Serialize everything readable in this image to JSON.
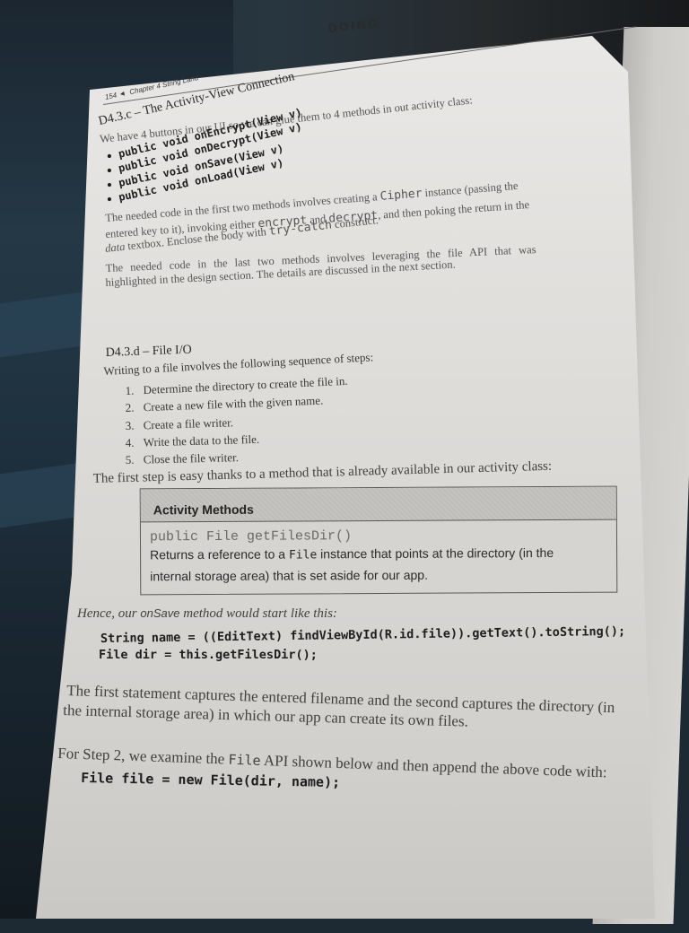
{
  "header": {
    "running_head": "DOING",
    "page_number": "154",
    "page_marker": "◄",
    "chapter": "Chapter 4  String Land"
  },
  "section_c": {
    "title": "D4.3.c – The Activity-View Connection",
    "intro": "We have 4 buttons in our UI so we can glue them to 4 methods in out activity class:",
    "methods": [
      "public void onEncrypt(View v)",
      "public void onDecrypt(View v)",
      "public void onSave(View v)",
      "public void onLoad(View v)"
    ],
    "para1": {
      "line1_a": "The needed code in the first two methods involves creating a ",
      "line1_code": "Cipher",
      "line1_b": " instance (passing the",
      "line2_a": "entered key to it), invoking either ",
      "line2_code1": "encrypt",
      "line2_b": " and ",
      "line2_code2": "decrypt",
      "line2_c": ", and then poking the return in the",
      "line3_code1": "data",
      "line3_a": " textbox. Enclose the body with ",
      "line3_code2": "try-catch",
      "line3_b": " construct."
    },
    "para2": {
      "line1": "The needed code in the last two methods involves leveraging the file API that was",
      "line2": "highlighted in the design section. The details are discussed in the next section."
    }
  },
  "section_d": {
    "title": "D4.3.d – File I/O",
    "intro": "Writing to a file involves the following sequence of steps:",
    "steps": [
      {
        "num": "1.",
        "text": "Determine the directory to create the file in."
      },
      {
        "num": "2.",
        "text": "Create a new file with the given name."
      },
      {
        "num": "3.",
        "text": "Create a file writer."
      },
      {
        "num": "4.",
        "text": "Write the data to the file."
      },
      {
        "num": "5.",
        "text": "Close the file writer."
      }
    ],
    "after_steps": "The first step is easy thanks to a method that is already available in our activity class:"
  },
  "activity_table": {
    "header": "Activity Methods",
    "signature": "public File getFilesDir()",
    "desc_a": "Returns a reference to a ",
    "desc_code": "File",
    "desc_b": " instance that points at the directory (in the",
    "desc_line2": "internal storage area) that is set aside for our app."
  },
  "onsave": {
    "intro_a": "Hence, our ",
    "intro_method": "onSave",
    "intro_b": " method would start like this:",
    "code_line1": "String name = ((EditText) findViewById(R.id.file)).getText().toString();",
    "code_line2": "File dir = this.getFilesDir();",
    "explain_line1": "The first statement captures the entered filename and the second captures the directory (in",
    "explain_line2": "the internal storage area) in which our app can create its own files."
  },
  "step2": {
    "line_a": "For Step 2, we examine the ",
    "line_code": "File",
    "line_b": " API shown below and then append the above code with:",
    "code": "File file = new File(dir, name);"
  }
}
